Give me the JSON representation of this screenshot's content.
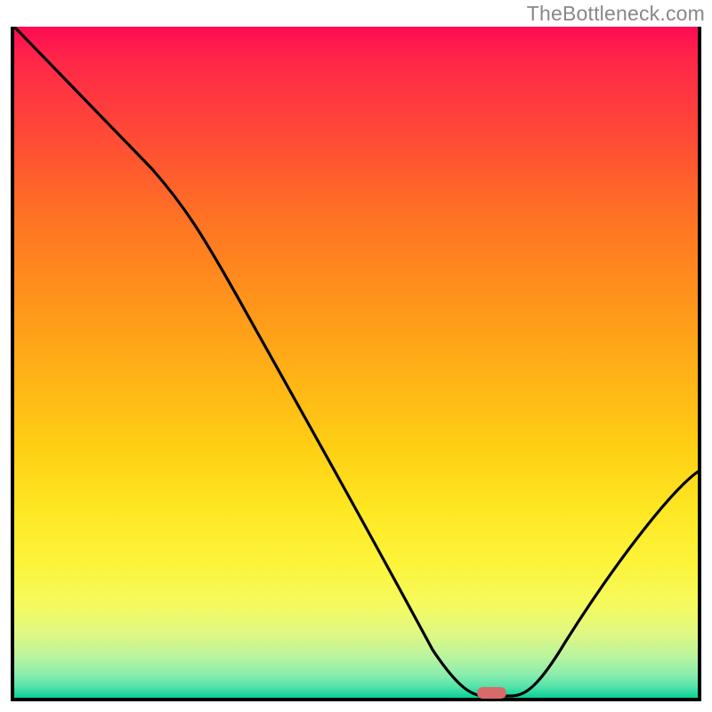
{
  "watermark": "TheBottleneck.com",
  "chart_data": {
    "type": "line",
    "title": "",
    "xlabel": "",
    "ylabel": "",
    "xlim": [
      0,
      100
    ],
    "ylim": [
      0,
      100
    ],
    "grid": false,
    "series": [
      {
        "name": "bottleneck-curve",
        "x": [
          0,
          20,
          60,
          68,
          72,
          76,
          100
        ],
        "values": [
          100,
          79,
          18,
          1,
          0,
          1,
          33
        ]
      }
    ],
    "marker": {
      "x": 70,
      "y": 0.5,
      "color": "#d96a6a"
    },
    "gradient_stops": [
      {
        "pos": 0,
        "color": "#ff0b52"
      },
      {
        "pos": 0.5,
        "color": "#ffb516"
      },
      {
        "pos": 0.85,
        "color": "#fdf43a"
      },
      {
        "pos": 1,
        "color": "#0bd094"
      }
    ],
    "annotations": []
  }
}
